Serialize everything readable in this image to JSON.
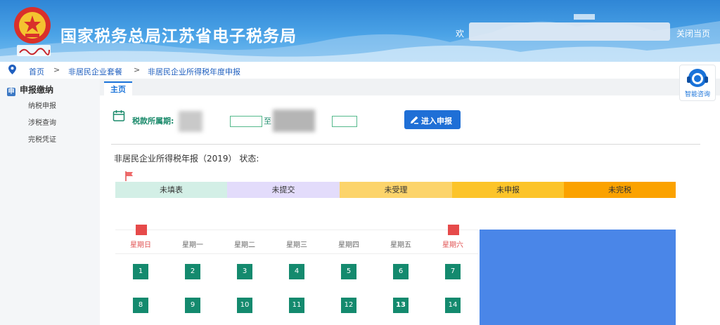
{
  "header": {
    "title": "国家税务总局江苏省电子税务局",
    "emblem_caption": "中国税务",
    "welcome_prefix": "欢",
    "close_label": "关闭当页"
  },
  "breadcrumb": {
    "items": [
      "首页",
      "非居民企业套餐",
      "非居民企业所得税年度申报"
    ],
    "separator": ">"
  },
  "sidebar": {
    "title": "申报缴纳",
    "title_icon": "申",
    "items": [
      "纳税申报",
      "涉税查询",
      "完税凭证"
    ]
  },
  "tabs": [
    {
      "label": "主页"
    }
  ],
  "assistant": {
    "label": "智能咨询"
  },
  "period": {
    "label": "税款所属期:",
    "to_label": "至"
  },
  "enter_button": {
    "label": "进入申报"
  },
  "status": {
    "title": "非居民企业所得税年报（2019）  状态:",
    "steps": [
      {
        "label": "未填表",
        "color": "#d3efe6"
      },
      {
        "label": "未提交",
        "color": "#e3dcfb"
      },
      {
        "label": "未受理",
        "color": "#fcd46b"
      },
      {
        "label": "未申报",
        "color": "#fcc42a"
      },
      {
        "label": "未完税",
        "color": "#fba200"
      }
    ]
  },
  "calendar": {
    "weekdays": [
      "星期日",
      "星期一",
      "星期二",
      "星期三",
      "星期四",
      "星期五",
      "星期六"
    ],
    "weeks": [
      [
        "1",
        "2",
        "3",
        "4",
        "5",
        "6",
        "7"
      ],
      [
        "8",
        "9",
        "10",
        "11",
        "12",
        "13",
        "14"
      ]
    ],
    "day_color": "#148a6e",
    "weekend_color": "#e05050"
  },
  "colors": {
    "brand_blue": "#1f6fd6",
    "header_blue": "#2f86d6",
    "accent_green": "#1b8a6b",
    "panel_blue": "#4a86e8"
  }
}
